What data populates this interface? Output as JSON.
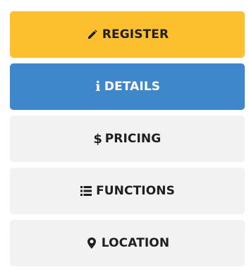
{
  "menu": {
    "items": [
      {
        "label": "REGISTER",
        "icon": "pencil-icon"
      },
      {
        "label": "DETAILS",
        "icon": "info-icon",
        "glyph": "i"
      },
      {
        "label": "PRICING",
        "icon": "dollar-icon",
        "glyph": "$"
      },
      {
        "label": "FUNCTIONS",
        "icon": "list-icon"
      },
      {
        "label": "LOCATION",
        "icon": "map-marker-icon"
      }
    ],
    "colors": {
      "register_bg": "#fcc02e",
      "details_bg": "#3f87cb",
      "default_bg": "#f2f2f2"
    }
  }
}
